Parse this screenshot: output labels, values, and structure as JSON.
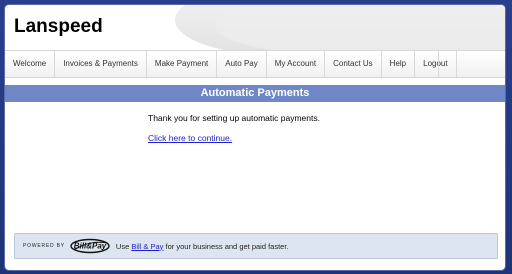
{
  "brand": {
    "name": "Lanspeed"
  },
  "nav": {
    "items": [
      {
        "label": "Welcome"
      },
      {
        "label": "Invoices & Payments"
      },
      {
        "label": "Make Payment"
      },
      {
        "label": "Auto Pay"
      },
      {
        "label": "My Account"
      },
      {
        "label": "Contact Us"
      },
      {
        "label": "Help"
      },
      {
        "label": "Logout"
      }
    ]
  },
  "page": {
    "title": "Automatic Payments",
    "message": "Thank you for setting up automatic payments.",
    "continue_link": "Click here to continue."
  },
  "footer": {
    "powered_by": "POWERED BY",
    "logo_text": "Bill&Pay",
    "text_before": "Use ",
    "link": "Bill & Pay",
    "text_after": " for your business and get paid faster."
  },
  "colors": {
    "background": "#1f3378",
    "banner": "#6f86c7",
    "link": "#2222cc",
    "footer_bg": "#dde6f0"
  }
}
